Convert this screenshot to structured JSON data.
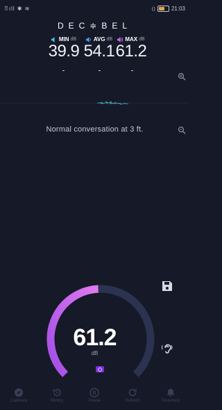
{
  "status_bar": {
    "left_text": "⠿ıll ✱ ≋",
    "right_text": "21:03"
  },
  "app": {
    "logo": "DEC≑BEL"
  },
  "stats": {
    "min": {
      "label": "MIN",
      "unit": "dB",
      "value": "39.9"
    },
    "avg": {
      "label": "AVG",
      "unit": "dB",
      "value": "54.1"
    },
    "max": {
      "label": "MAX",
      "unit": "dB",
      "value": "61.2"
    }
  },
  "description": "Normal conversation at 3 ft.",
  "gauge": {
    "value": "61.2",
    "unit": "dB",
    "level_fraction": 0.49
  },
  "nav": {
    "items": [
      {
        "label": "Calibrate",
        "icon": "compass-icon"
      },
      {
        "label": "History",
        "icon": "history-icon"
      },
      {
        "label": "Pause",
        "icon": "pause-icon"
      },
      {
        "label": "Refresh",
        "icon": "refresh-icon"
      },
      {
        "label": "Threshold",
        "icon": "bell-icon"
      }
    ]
  },
  "colors": {
    "background": "#161927",
    "gauge_track": "#2c3350",
    "gauge_start": "#e07af0",
    "gauge_end": "#a04ee6",
    "accent": "#7a2fd8"
  }
}
